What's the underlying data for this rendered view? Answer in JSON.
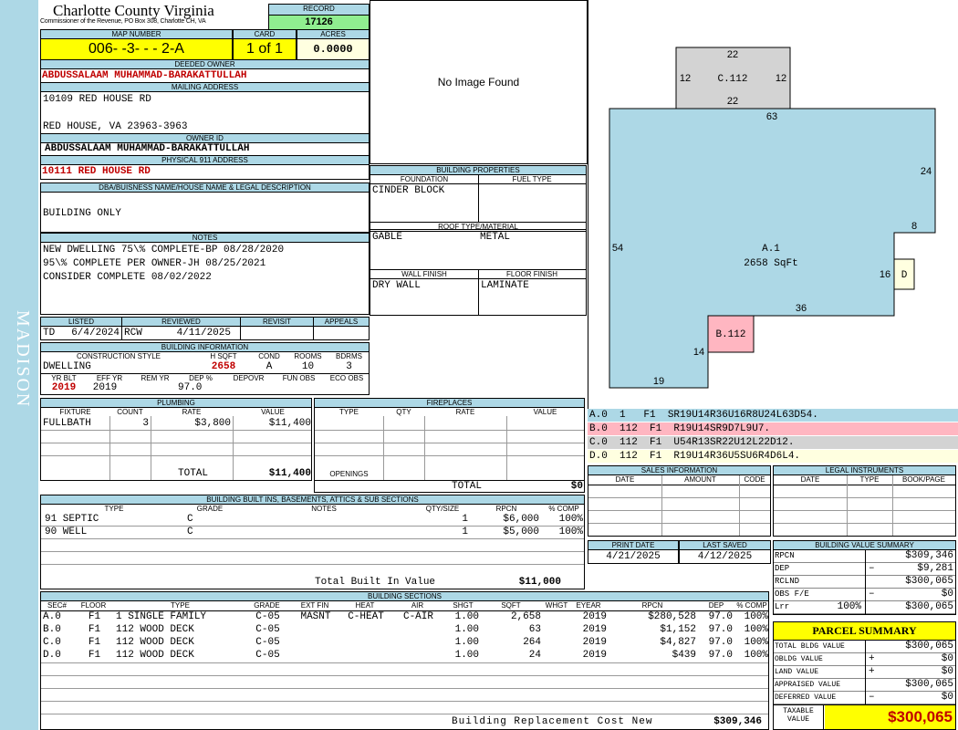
{
  "side_label": "MADISON",
  "county": {
    "name": "Charlotte County Virginia",
    "sub": "Commissioner of the Revenue, PO Box 308, Charlotte CH, VA"
  },
  "record": {
    "label": "RECORD",
    "value": "17126"
  },
  "map": {
    "label": "MAP NUMBER",
    "value": "006- -3- - - 2-A"
  },
  "card": {
    "label": "CARD",
    "value": "1 of 1"
  },
  "acres": {
    "label": "ACRES",
    "value": "0.0000"
  },
  "owner": {
    "deeded_label": "DEEDED OWNER",
    "deeded": "ABDUSSALAAM MUHAMMAD-BARAKATTULLAH",
    "mailing_label": "MAILING ADDRESS",
    "mail1": "10109 RED HOUSE RD",
    "mail2": "RED HOUSE, VA 23963-3963",
    "id_label": "OWNER ID",
    "id_value": "ABDUSSALAAM MUHAMMAD-BARAKATTULLAH",
    "phys_label": "PHYSICAL 911 ADDRESS",
    "phys": "10111 RED HOUSE RD"
  },
  "dba": {
    "label": "DBA/BUISNESS NAME/HOUSE NAME & LEGAL DESCRIPTION",
    "value": "BUILDING ONLY"
  },
  "notes": {
    "label": "NOTES",
    "lines": [
      "NEW DWELLING 75\\% COMPLETE-BP 08/28/2020",
      "95\\% COMPLETE PER OWNER-JH 08/25/2021",
      "CONSIDER COMPLETE 08/02/2022"
    ]
  },
  "image_text": "No Image Found",
  "bp": {
    "title": "BUILDING PROPERTIES",
    "foundation_label": "FOUNDATION",
    "fuel_label": "FUEL TYPE",
    "foundation": "CINDER BLOCK",
    "roof_label": "ROOF TYPE/MATERIAL",
    "roof_type": "GABLE",
    "roof_mat": "METAL",
    "wall_label": "WALL FINISH",
    "floor_label": "FLOOR FINISH",
    "wall": "DRY WALL",
    "floor": "LAMINATE"
  },
  "listed": {
    "label": "LISTED",
    "by": "TD",
    "date": "6/4/2024"
  },
  "reviewed": {
    "label": "REVIEWED",
    "by": "RCW",
    "date": "4/11/2025"
  },
  "revisit": {
    "label": "REVISIT"
  },
  "appeals": {
    "label": "APPEALS"
  },
  "binfo": {
    "title": "BUILDING INFORMATION",
    "h": {
      "style": "CONSTRUCTION STYLE",
      "hsqft": "H SQFT",
      "cond": "COND",
      "rooms": "ROOMS",
      "bdrms": "BDRMS"
    },
    "v": {
      "style": "DWELLING",
      "hsqft": "2658",
      "cond": "A",
      "rooms": "10",
      "bdrms": "3"
    },
    "h2": {
      "yrblt": "YR BLT",
      "effyr": "EFF YR",
      "remyr": "REM YR",
      "dep": "DEP %",
      "depovr": "DEPOVR",
      "funobs": "FUN OBS",
      "ecoobs": "ECO OBS"
    },
    "v2": {
      "yrblt": "2019",
      "effyr": "2019",
      "remyr": "",
      "dep": "97.0",
      "depovr": "",
      "funobs": "",
      "ecoobs": ""
    }
  },
  "plumbing": {
    "title": "PLUMBING",
    "h": {
      "fixture": "FIXTURE",
      "count": "COUNT",
      "rate": "RATE",
      "value": "VALUE"
    },
    "rows": [
      {
        "fixture": "FULLBATH",
        "count": "3",
        "rate": "$3,800",
        "value": "$11,400"
      }
    ],
    "total_label": "TOTAL",
    "total": "$11,400"
  },
  "fireplaces": {
    "title": "FIREPLACES",
    "h": {
      "type": "TYPE",
      "qty": "QTY",
      "rate": "RATE",
      "value": "VALUE"
    },
    "openings": "OPENINGS",
    "total_label": "TOTAL",
    "total": "$0"
  },
  "builtins": {
    "title": "BUILDING BUILT INS, BASEMENTS, ATTICS & SUB SECTIONS",
    "h": {
      "type": "TYPE",
      "grade": "GRADE",
      "notes": "NOTES",
      "qty": "QTY/SIZE",
      "rpcn": "RPCN",
      "comp": "% COMP"
    },
    "rows": [
      {
        "type": "91 SEPTIC",
        "grade": "C",
        "notes": "",
        "qty": "1",
        "rpcn": "$6,000",
        "comp": "100%"
      },
      {
        "type": "90 WELL",
        "grade": "C",
        "notes": "",
        "qty": "1",
        "rpcn": "$5,000",
        "comp": "100%"
      }
    ],
    "total_label": "Total Built In Value",
    "total": "$11,000"
  },
  "sections": {
    "title": "BUILDING SECTIONS",
    "h": {
      "sec": "SEC#",
      "floor": "FLOOR",
      "type": "TYPE",
      "grade": "GRADE",
      "extfin": "EXT FIN",
      "heat": "HEAT",
      "air": "AIR",
      "shgt": "SHGT",
      "sqft": "SQFT",
      "whgt": "WHGT",
      "eyear": "EYEAR",
      "rpcn": "RPCN",
      "dep": "DEP",
      "comp": "% COMP"
    },
    "rows": [
      {
        "sec": "A.0",
        "floor": "F1",
        "type": "1 SINGLE FAMILY",
        "grade": "C-05",
        "extfin": "MASNT",
        "heat": "C-HEAT",
        "air": "C-AIR",
        "shgt": "1.00",
        "sqft": "2,658",
        "whgt": "",
        "eyear": "2019",
        "rpcn": "$280,528",
        "dep": "97.0",
        "comp": "100%"
      },
      {
        "sec": "B.0",
        "floor": "F1",
        "type": "112 WOOD DECK",
        "grade": "C-05",
        "extfin": "",
        "heat": "",
        "air": "",
        "shgt": "1.00",
        "sqft": "63",
        "whgt": "",
        "eyear": "2019",
        "rpcn": "$1,152",
        "dep": "97.0",
        "comp": "100%"
      },
      {
        "sec": "C.0",
        "floor": "F1",
        "type": "112 WOOD DECK",
        "grade": "C-05",
        "extfin": "",
        "heat": "",
        "air": "",
        "shgt": "1.00",
        "sqft": "264",
        "whgt": "",
        "eyear": "2019",
        "rpcn": "$4,827",
        "dep": "97.0",
        "comp": "100%"
      },
      {
        "sec": "D.0",
        "floor": "F1",
        "type": "112 WOOD DECK",
        "grade": "C-05",
        "extfin": "",
        "heat": "",
        "air": "",
        "shgt": "1.00",
        "sqft": "24",
        "whgt": "",
        "eyear": "2019",
        "rpcn": "$439",
        "dep": "97.0",
        "comp": "100%"
      }
    ],
    "total_label": "Building Replacement Cost New",
    "total": "$309,346"
  },
  "sketch": {
    "c_label": "C.112",
    "c_top": "22",
    "c_left": "12",
    "c_right": "12",
    "c_bottom": "22",
    "a_label": "A.1",
    "a_area": "2658 SqFt",
    "d63": "63",
    "d24": "24",
    "d8": "8",
    "d54": "54",
    "d16": "16",
    "d36": "36",
    "d14": "14",
    "d19": "19",
    "b_label": "B.112",
    "d_label": "D"
  },
  "legend": [
    {
      "text": "A.0  1   F1  SR19U14R36U16R8U24L63D54.",
      "color": "#add8e6"
    },
    {
      "text": "B.0  112  F1  R19U14SR9D7L9U7.",
      "color": "#ffb6c1"
    },
    {
      "text": "C.0  112  F1  U54R13SR22U12L22D12.",
      "color": "#d3d3d3"
    },
    {
      "text": "D.0  112  F1  R19U14R36U5SU6R4D6L4.",
      "color": "#ffffe0"
    }
  ],
  "sales": {
    "title": "SALES INFORMATION",
    "h": {
      "date": "DATE",
      "amount": "AMOUNT",
      "code": "CODE"
    }
  },
  "legal": {
    "title": "LEGAL INSTRUMENTS",
    "h": {
      "date": "DATE",
      "type": "TYPE",
      "book": "BOOK/PAGE"
    }
  },
  "print": {
    "label": "PRINT DATE",
    "value": "4/21/2025"
  },
  "saved": {
    "label": "LAST SAVED",
    "value": "4/12/2025"
  },
  "bvs": {
    "title": "BUILDING VALUE SUMMARY",
    "rows": [
      {
        "label": "RPCN",
        "sign": "",
        "pct": "",
        "value": "$309,346"
      },
      {
        "label": "DEP",
        "sign": "–",
        "pct": "",
        "value": "$9,281"
      },
      {
        "label": "RCLND",
        "sign": "",
        "pct": "",
        "value": "$300,065"
      },
      {
        "label": "OBS F/E",
        "sign": "–",
        "pct": "",
        "value": "$0"
      },
      {
        "label": "Lrr",
        "sign": "",
        "pct": "100%",
        "value": "$300,065"
      }
    ]
  },
  "parcel": {
    "title": "PARCEL SUMMARY",
    "rows": [
      {
        "label": "TOTAL BLDG VALUE",
        "sign": "",
        "value": "$300,065"
      },
      {
        "label": "OBLDG VALUE",
        "sign": "+",
        "value": "$0"
      },
      {
        "label": "LAND VALUE",
        "sign": "+",
        "value": "$0"
      },
      {
        "label": "APPRAISED VALUE",
        "sign": "",
        "value": "$300,065"
      },
      {
        "label": "DEFERRED VALUE",
        "sign": "–",
        "value": "$0"
      }
    ],
    "taxable_label": "TAXABLE VALUE",
    "taxable": "$300,065"
  },
  "colors": {
    "header": "#add8e6",
    "sidebar": "#add8e6",
    "yellow": "#ffff00",
    "record_green": "#90ee90",
    "red": "#c00000"
  }
}
